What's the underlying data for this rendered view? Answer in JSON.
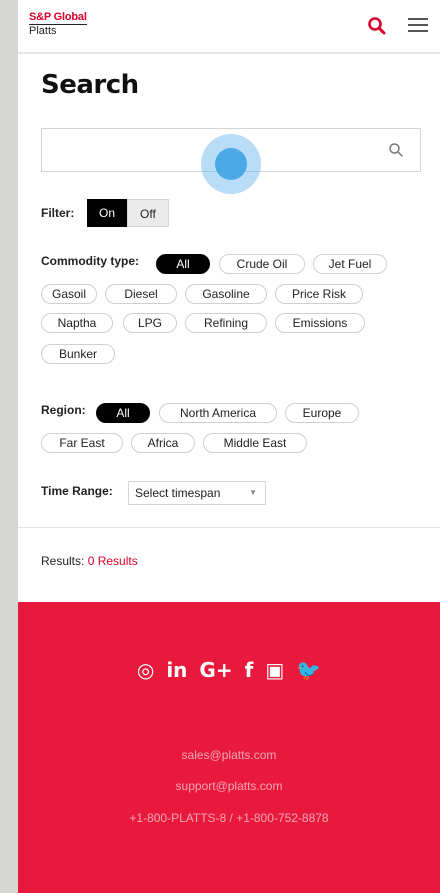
{
  "header": {
    "logo_line1": "S&P Global",
    "logo_line2": "Platts",
    "search_icon": "search-icon",
    "menu_icon": "hamburger-menu-icon",
    "accent": "#d6002a"
  },
  "page_title": "Search",
  "search": {
    "value": "",
    "placeholder": ""
  },
  "filter": {
    "label": "Filter:",
    "on": "On",
    "off": "Off",
    "active": "On"
  },
  "commodity": {
    "label": "Commodity type:",
    "options": [
      "All",
      "Crude Oil",
      "Jet Fuel",
      "Gasoil",
      "Diesel",
      "Gasoline",
      "Price Risk",
      "Naptha",
      "LPG",
      "Refining",
      "Emissions",
      "Bunker"
    ],
    "selected": "All"
  },
  "region": {
    "label": "Region:",
    "options": [
      "All",
      "North America",
      "Europe",
      "Far East",
      "Africa",
      "Middle East"
    ],
    "selected": "All"
  },
  "time_range": {
    "label": "Time Range:",
    "selected": "Select timespan"
  },
  "results": {
    "label": "Results:",
    "count": "0 Results"
  },
  "footer": {
    "bg_color": "#e8193c",
    "social": [
      {
        "icon": "instagram-icon",
        "glyph": "◎"
      },
      {
        "icon": "linkedin-icon",
        "glyph": "in"
      },
      {
        "icon": "google-plus-icon",
        "glyph": "G+"
      },
      {
        "icon": "facebook-icon",
        "glyph": "f"
      },
      {
        "icon": "youtube-icon",
        "glyph": "▣"
      },
      {
        "icon": "twitter-icon",
        "glyph": "🐦"
      }
    ],
    "email_sales": "sales@platts.com",
    "email_support": "support@platts.com",
    "phone": "+1-800-PLATTS-8 / +1-800-752-8878"
  }
}
